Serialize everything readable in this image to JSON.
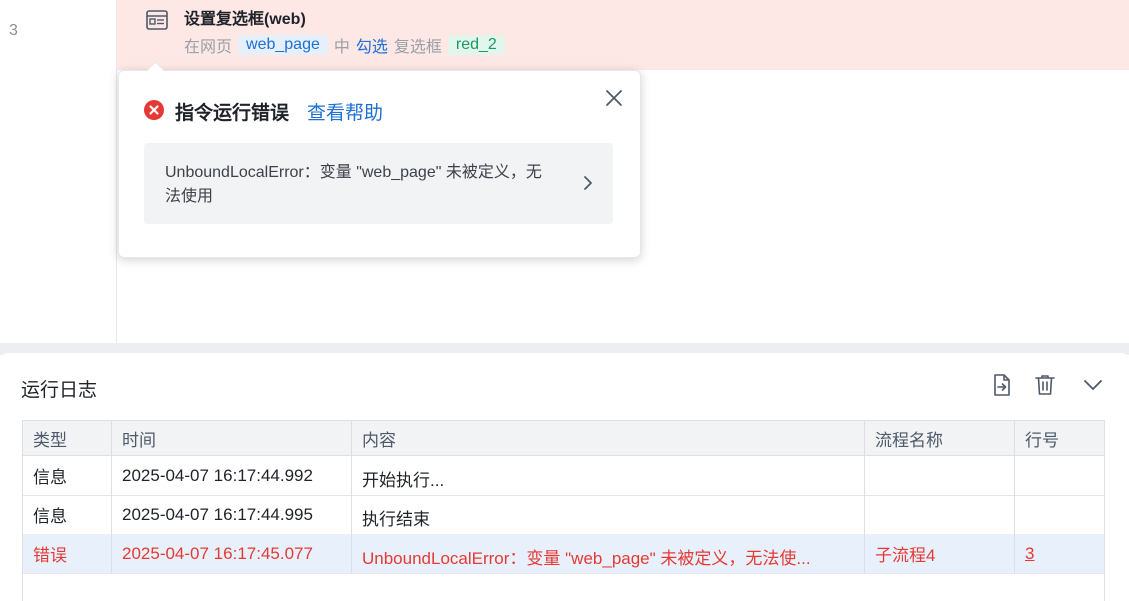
{
  "editor": {
    "line_number": "3",
    "step": {
      "title": "设置复选框(web)",
      "desc_prefix": "在网页",
      "web_page_var": "web_page",
      "desc_mid": "中",
      "action": "勾选",
      "desc_obj": "复选框",
      "element_name": "red_2"
    }
  },
  "popup": {
    "title": "指令运行错误",
    "help_link": "查看帮助",
    "error_message": "UnboundLocalError：变量 \"web_page\" 未被定义，无法使用",
    "icons": {
      "error": "error-circle-icon",
      "close": "close-icon",
      "expand": "chevron-right-icon"
    }
  },
  "log": {
    "title": "运行日志",
    "tools": {
      "export": "export-icon",
      "delete": "trash-icon",
      "collapse": "chevron-down-icon"
    },
    "columns": [
      "类型",
      "时间",
      "内容",
      "流程名称",
      "行号"
    ],
    "rows": [
      {
        "type": "信息",
        "time": "2025-04-07 16:17:44.992",
        "content": "开始执行...",
        "flow": "",
        "line": ""
      },
      {
        "type": "信息",
        "time": "2025-04-07 16:17:44.995",
        "content": "执行结束",
        "flow": "",
        "line": ""
      },
      {
        "type": "错误",
        "time": "2025-04-07 16:17:45.077",
        "content": "UnboundLocalError：变量 \"web_page\" 未被定义，无法使...",
        "flow": "子流程4",
        "line": "3"
      }
    ]
  },
  "colors": {
    "error_row_bg": "#fde8e6",
    "error_text": "#e53935",
    "link": "#1d6fd6",
    "selected_row": "#e8f1fb"
  }
}
